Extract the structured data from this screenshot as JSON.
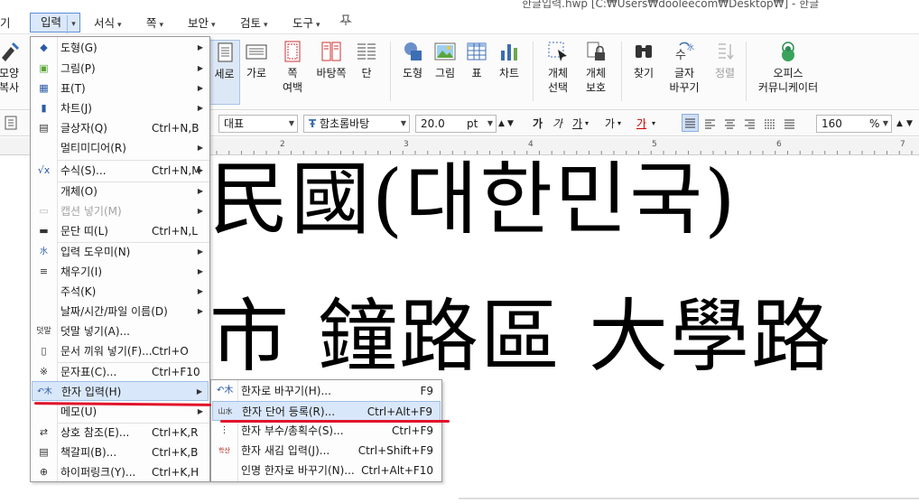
{
  "window": {
    "title": "한글입력.hwp [C:₩Users₩dooleecom₩Desktop₩] - 한글"
  },
  "menubar": {
    "partial_left": "기",
    "items": [
      {
        "label": "입력",
        "active": true
      },
      {
        "label": "서식"
      },
      {
        "label": "쪽"
      },
      {
        "label": "보안"
      },
      {
        "label": "검토"
      },
      {
        "label": "도구"
      }
    ]
  },
  "ribbon": {
    "left_partial": {
      "line1": "모양",
      "line2": "복사"
    },
    "buttons": [
      {
        "label": "세로",
        "selected": true
      },
      {
        "label": "가로"
      },
      {
        "label": "쪽",
        "line2": "여백"
      },
      {
        "label": "바탕쪽"
      },
      {
        "label": "단"
      },
      {
        "label": "도형"
      },
      {
        "label": "그림"
      },
      {
        "label": "표"
      },
      {
        "label": "차트"
      },
      {
        "label": "개체",
        "line2": "선택"
      },
      {
        "label": "개체",
        "line2": "보호"
      },
      {
        "label": "찾기"
      },
      {
        "label": "글자",
        "line2": "바꾸기"
      },
      {
        "label": "정렬",
        "disabled": true
      },
      {
        "label": "오피스",
        "line2": "커뮤니케이터"
      }
    ]
  },
  "formatbar": {
    "style": "대표",
    "font": "함초롬바탕",
    "size": "20.0",
    "unit": "pt",
    "buttons": [
      "가",
      "가",
      "가",
      "가",
      "가"
    ],
    "zoom": "160",
    "zoom_unit": "%"
  },
  "ruler": {
    "ticks": [
      "2",
      "3",
      "4",
      "5",
      "6",
      "7"
    ]
  },
  "document": {
    "line1": "民國(대한민국)",
    "line2": "市  鐘路區  大學路"
  },
  "input_menu": {
    "items": [
      {
        "label": "도형(G)",
        "shortcut": "",
        "submenu": true,
        "icon": "shape-icon"
      },
      {
        "label": "그림(P)",
        "shortcut": "",
        "submenu": true,
        "icon": "picture-icon"
      },
      {
        "label": "표(T)",
        "shortcut": "",
        "submenu": true,
        "icon": "table-icon"
      },
      {
        "label": "차트(J)",
        "shortcut": "",
        "submenu": true,
        "icon": "chart-icon"
      },
      {
        "label": "글상자(Q)",
        "shortcut": "Ctrl+N,B",
        "icon": "textbox-icon"
      },
      {
        "label": "멀티미디어(R)",
        "shortcut": "",
        "submenu": true,
        "icon": ""
      },
      {
        "label": "수식(S)...",
        "shortcut": "Ctrl+N,M",
        "submenu": true,
        "icon": "formula-icon"
      },
      {
        "label": "개체(O)",
        "shortcut": "",
        "submenu": true,
        "icon": ""
      },
      {
        "label": "캡션 넣기(M)",
        "shortcut": "",
        "submenu": true,
        "disabled": true,
        "icon": "caption-icon"
      },
      {
        "label": "문단 띠(L)",
        "shortcut": "Ctrl+N,L",
        "icon": "paragraph-band-icon"
      },
      {
        "label": "입력 도우미(N)",
        "shortcut": "",
        "submenu": true,
        "icon": "input-helper-icon"
      },
      {
        "label": "채우기(I)",
        "shortcut": "",
        "submenu": true,
        "icon": "fill-icon"
      },
      {
        "label": "주석(K)",
        "shortcut": "",
        "submenu": true,
        "icon": ""
      },
      {
        "label": "날짜/시간/파일 이름(D)",
        "shortcut": "",
        "submenu": true,
        "icon": ""
      },
      {
        "label": "덧말 넣기(A)...",
        "shortcut": "",
        "icon": "annotation-icon"
      },
      {
        "label": "문서 끼워 넣기(F)...",
        "shortcut": "Ctrl+O",
        "icon": "insert-doc-icon"
      },
      {
        "label": "문자표(C)...",
        "shortcut": "Ctrl+F10",
        "icon": "symbol-icon"
      },
      {
        "label": "한자 입력(H)",
        "shortcut": "",
        "submenu": true,
        "highlighted": true,
        "icon": "hanja-icon"
      },
      {
        "label": "메모(U)",
        "shortcut": "",
        "submenu": true,
        "icon": ""
      },
      {
        "label": "상호 참조(E)...",
        "shortcut": "Ctrl+K,R",
        "icon": "cross-ref-icon"
      },
      {
        "label": "책갈피(B)...",
        "shortcut": "Ctrl+K,B",
        "icon": "bookmark-icon"
      },
      {
        "label": "하이퍼링크(Y)...",
        "shortcut": "Ctrl+K,H",
        "icon": "hyperlink-icon"
      }
    ]
  },
  "hanja_submenu": {
    "items": [
      {
        "label": "한자로 바꾸기(H)...",
        "shortcut": "F9",
        "icon": "hanja-convert-icon"
      },
      {
        "label": "한자 단어 등록(R)...",
        "shortcut": "Ctrl+Alt+F9",
        "highlighted": true,
        "icon": "hanja-register-icon"
      },
      {
        "label": "한자 부수/총획수(S)...",
        "shortcut": "Ctrl+F9",
        "icon": "hanja-radical-icon"
      },
      {
        "label": "한자 새김 입력(J)...",
        "shortcut": "Ctrl+Shift+F9",
        "icon": "hanja-meaning-icon"
      },
      {
        "label": "인명 한자로 바꾸기(N)...",
        "shortcut": "Ctrl+Alt+F10",
        "icon": ""
      }
    ]
  },
  "icon_glyphs": {
    "hanja_icon": "↶木",
    "hanja_register_icon": "山水",
    "hanja_meaning_icon": "학산"
  },
  "colors": {
    "menu_highlight": "#d9e7fa",
    "active_border": "#5a8fd6",
    "annotation_red": "#e0142b"
  }
}
